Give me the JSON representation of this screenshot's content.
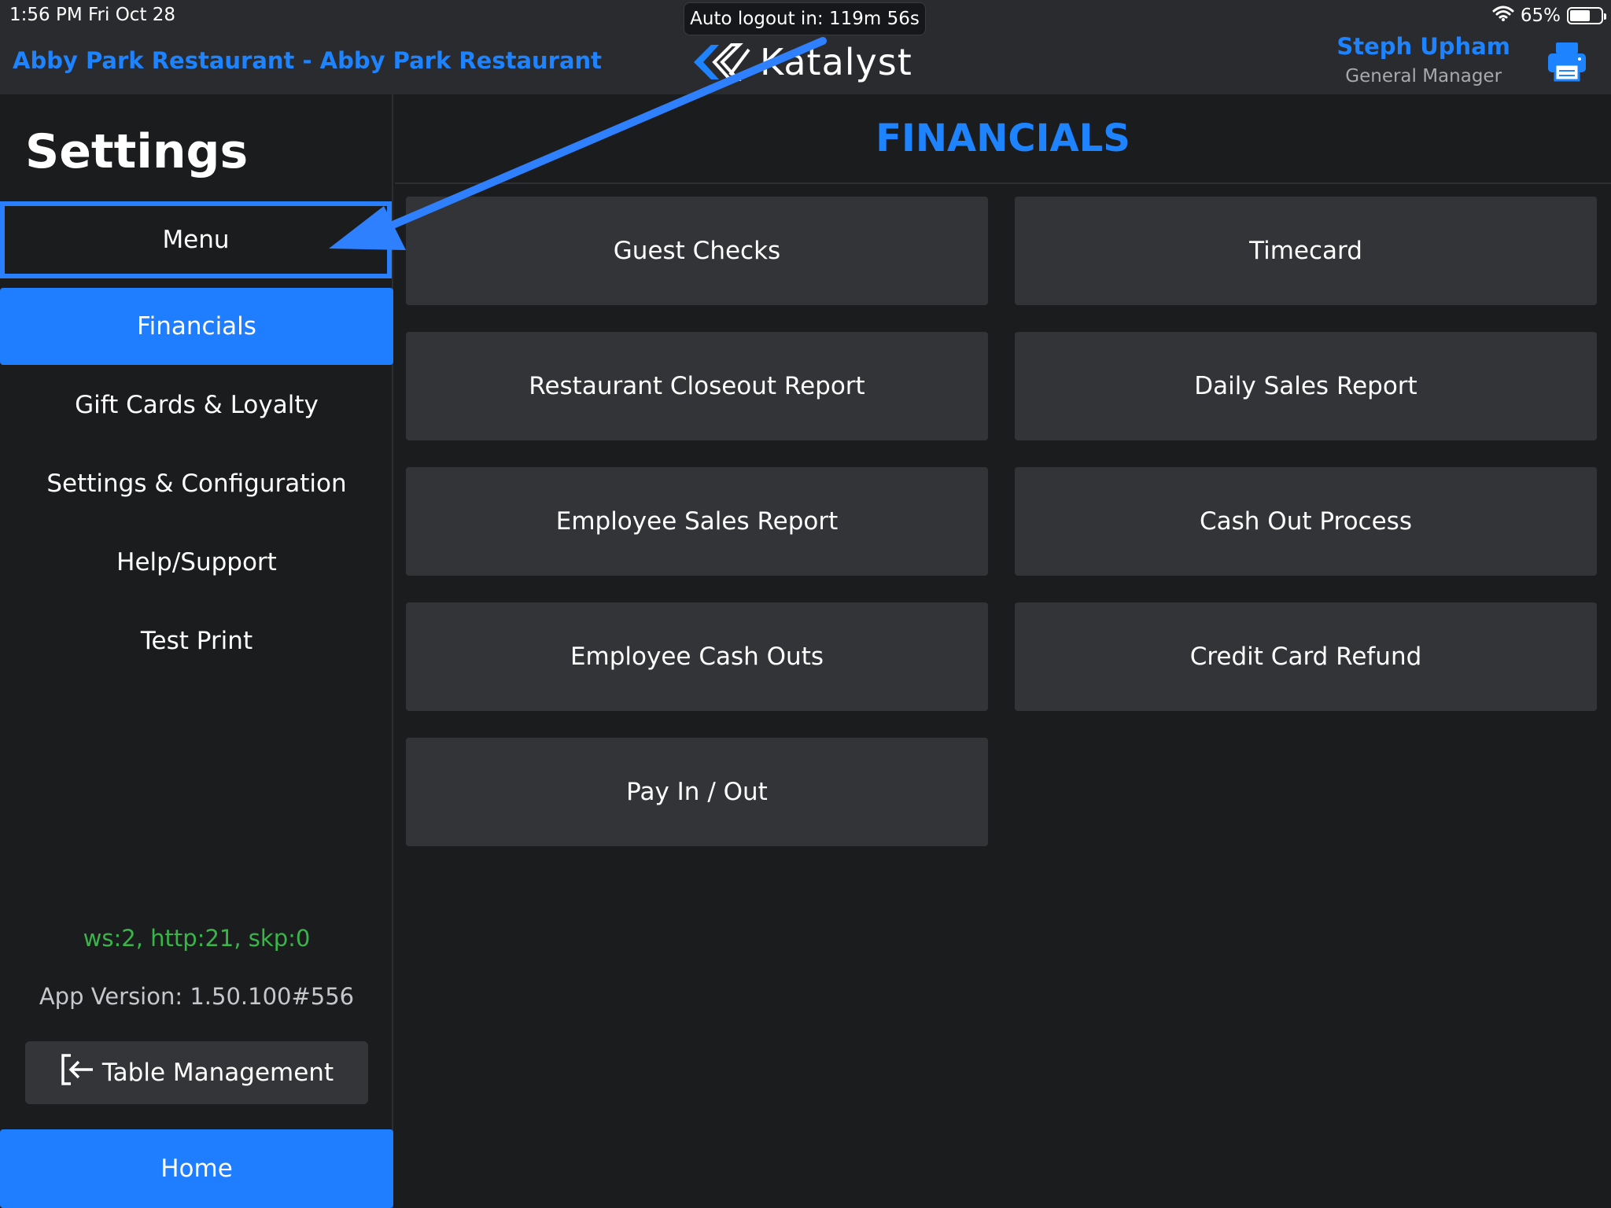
{
  "status_bar": {
    "time_date": "1:56 PM   Fri Oct 28",
    "battery_percent": "65%",
    "battery_level": 0.65,
    "wifi_icon": "wifi-icon"
  },
  "header": {
    "auto_logout": "Auto logout in: 119m 56s",
    "restaurant": "Abby Park Restaurant - Abby Park Restaurant",
    "logo_text": "Katalyst",
    "user_name": "Steph Upham",
    "user_role": "General Manager",
    "printer_icon": "printer-icon",
    "accent_color": "#1d83ff"
  },
  "sidebar": {
    "title": "Settings",
    "items": [
      {
        "label": "Menu"
      },
      {
        "label": "Financials"
      },
      {
        "label": "Gift Cards & Loyalty"
      },
      {
        "label": "Settings & Configuration"
      },
      {
        "label": "Help/Support"
      },
      {
        "label": "Test Print"
      }
    ],
    "stats": "ws:2, http:21, skp:0",
    "version": "App Version: 1.50.100#556",
    "table_management": "Table Management",
    "home": "Home"
  },
  "main": {
    "title": "FINANCIALS",
    "tiles": [
      {
        "label": "Guest Checks"
      },
      {
        "label": "Timecard"
      },
      {
        "label": "Restaurant Closeout Report"
      },
      {
        "label": "Daily Sales Report"
      },
      {
        "label": "Employee Sales Report"
      },
      {
        "label": "Cash Out Process"
      },
      {
        "label": "Employee Cash Outs"
      },
      {
        "label": "Credit Card Refund"
      },
      {
        "label": "Pay In / Out"
      }
    ]
  }
}
